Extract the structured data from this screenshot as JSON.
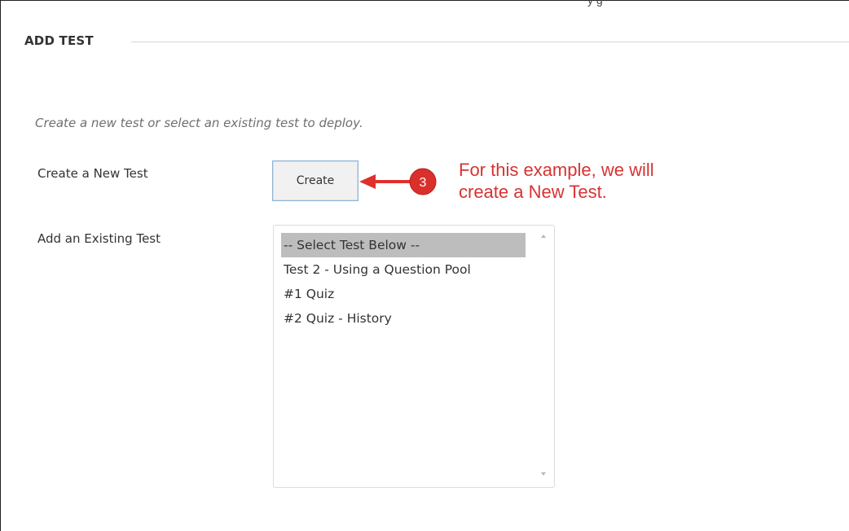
{
  "top_clip": "y                                                     g",
  "section": {
    "title": "ADD TEST",
    "instructions": "Create a new test or select an existing test to deploy."
  },
  "create_row": {
    "label": "Create a New Test",
    "button_label": "Create"
  },
  "existing_row": {
    "label": "Add an Existing Test",
    "options": [
      "-- Select Test Below --",
      "Test 2 - Using a Question Pool",
      "#1 Quiz",
      "#2 Quiz - History"
    ],
    "selected_index": 0
  },
  "annotation": {
    "step_number": "3",
    "line1": "For this example, we will",
    "line2": "create a New Test.",
    "color": "#d93232"
  },
  "colors": {
    "selected_option_bg": "#bdbdbd",
    "button_border": "#8fb3d6"
  }
}
